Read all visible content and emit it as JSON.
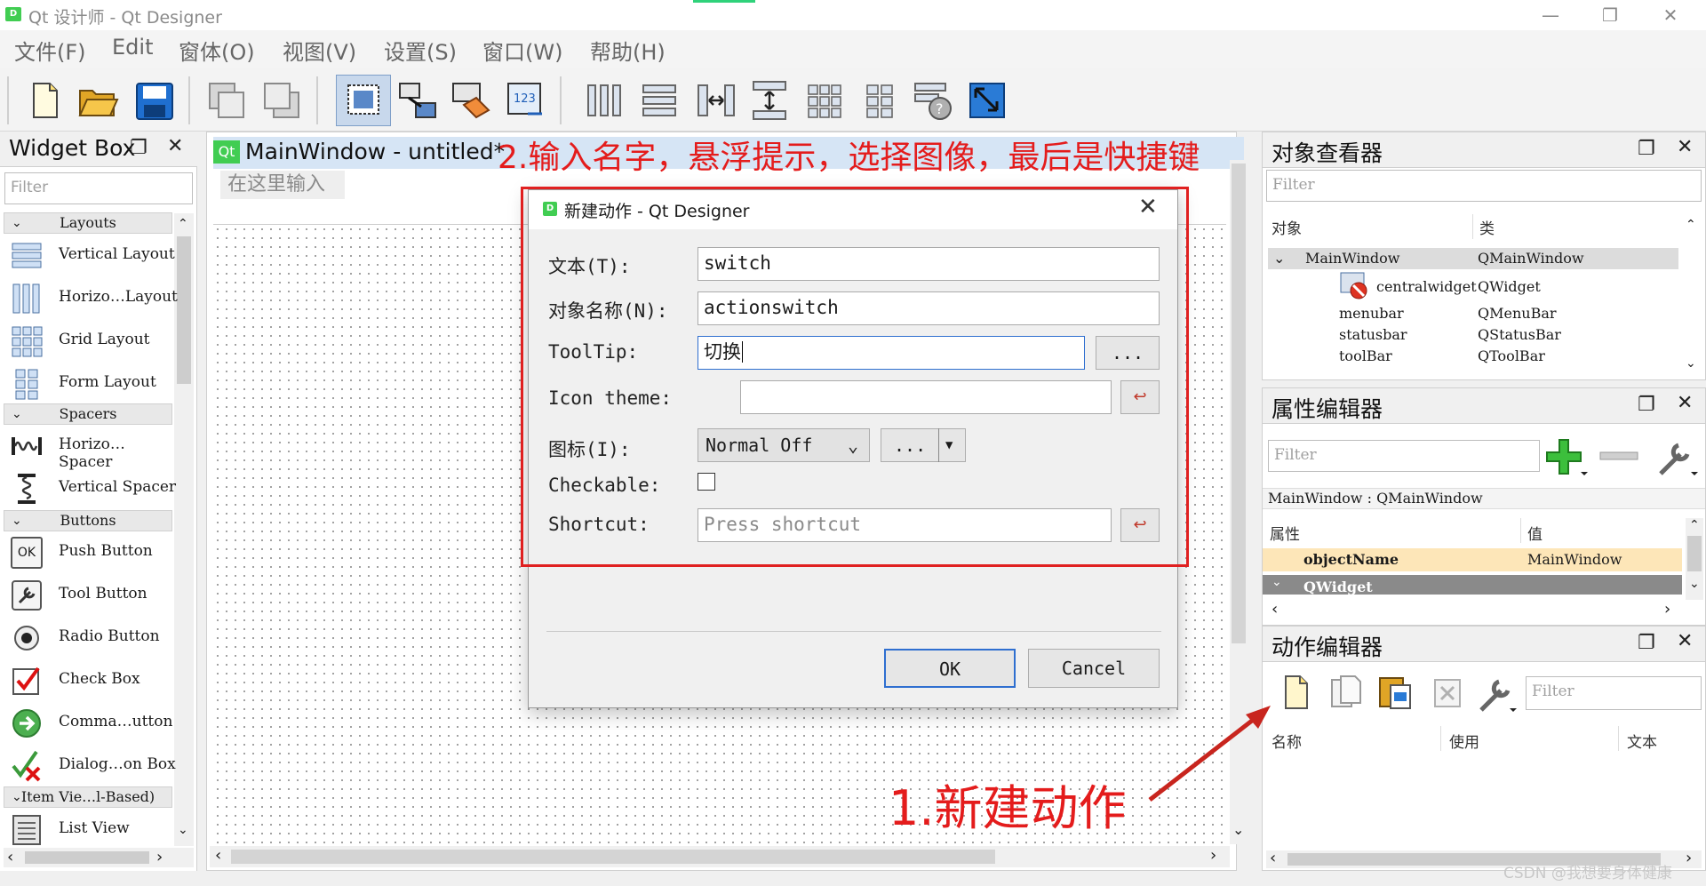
{
  "window": {
    "title": "Qt 设计师 - Qt Designer",
    "icon_label": "D"
  },
  "menu": [
    "文件(F)",
    "Edit",
    "窗体(O)",
    "视图(V)",
    "设置(S)",
    "窗口(W)",
    "帮助(H)"
  ],
  "widget_box": {
    "title": "Widget Box",
    "filter_placeholder": "Filter",
    "categories": {
      "layouts": "Layouts",
      "spacers": "Spacers",
      "buttons": "Buttons",
      "item_views": "Item Vie…l-Based)"
    },
    "items": {
      "vertical_layout": "Vertical Layout",
      "horizontal_layout": "Horizo…Layout",
      "grid_layout": "Grid Layout",
      "form_layout": "Form Layout",
      "horizontal_spacer": "Horizo…Spacer",
      "vertical_spacer": "Vertical Spacer",
      "push_button": "Push Button",
      "tool_button": "Tool Button",
      "radio_button": "Radio Button",
      "check_box": "Check Box",
      "command_link": "Comma…utton",
      "dialog_button_box": "Dialog…on Box",
      "list_view": "List View"
    },
    "push_button_icon_text": "OK"
  },
  "editor": {
    "badge": "Qt",
    "title": "MainWindow - untitled*",
    "type_here": "在这里输入"
  },
  "annotations": {
    "step2": "2.输入名字，悬浮提示，选择图像，最后是快捷键",
    "step1": "1.新建动作"
  },
  "dialog": {
    "title": "新建动作 - Qt Designer",
    "icon_label": "D",
    "labels": {
      "text": "文本(T):",
      "object_name": "对象名称(N):",
      "tooltip": "ToolTip:",
      "icon_theme": "Icon theme:",
      "icon": "图标(I):",
      "checkable": "Checkable:",
      "shortcut": "Shortcut:"
    },
    "values": {
      "text": "switch",
      "object_name": "actionswitch",
      "tooltip": "切换",
      "icon_theme": "",
      "icon_mode": "Normal Off",
      "shortcut_placeholder": "Press shortcut"
    },
    "browse_label": "...",
    "ok": "OK",
    "cancel": "Cancel"
  },
  "object_inspector": {
    "title": "对象查看器",
    "filter_placeholder": "Filter",
    "col_object": "对象",
    "col_class": "类",
    "rows": [
      {
        "object": "MainWindow",
        "class": "QMainWindow"
      },
      {
        "object": "centralwidget",
        "class": "QWidget"
      },
      {
        "object": "menubar",
        "class": "QMenuBar"
      },
      {
        "object": "statusbar",
        "class": "QStatusBar"
      },
      {
        "object": "toolBar",
        "class": "QToolBar"
      }
    ]
  },
  "property_editor": {
    "title": "属性编辑器",
    "filter_placeholder": "Filter",
    "context": "MainWindow : QMainWindow",
    "col_property": "属性",
    "col_value": "值",
    "rows": [
      {
        "property": "objectName",
        "value": "MainWindow"
      },
      {
        "property": "QWidget",
        "value": ""
      }
    ]
  },
  "action_editor": {
    "title": "动作编辑器",
    "filter_placeholder": "Filter",
    "col_name": "名称",
    "col_used": "使用",
    "col_text": "文本"
  },
  "watermark": "CSDN @我想要身体健康"
}
